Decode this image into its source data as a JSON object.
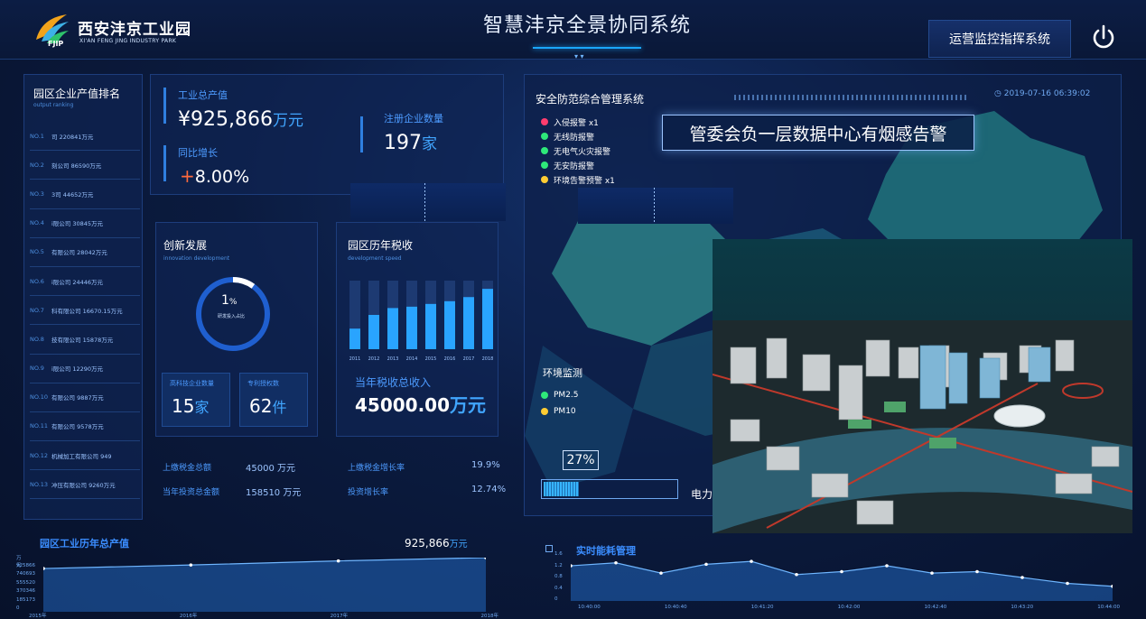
{
  "header": {
    "logo_cn": "西安沣京工业园",
    "logo_en": "XI'AN FENG JING INDUSTRY PARK",
    "logo_abbr": "FJIP",
    "title": "智慧沣京全景协同系统",
    "ops_button": "运营监控指挥系统",
    "power_icon": "power-icon"
  },
  "ranking": {
    "title": "园区企业产值排名",
    "subtitle": "output ranking",
    "items": [
      {
        "no": "NO.1",
        "text": "司 220841万元"
      },
      {
        "no": "NO.2",
        "text": "刻公司 86590万元"
      },
      {
        "no": "NO.3",
        "text": "3司 44652万元"
      },
      {
        "no": "NO.4",
        "text": "i限公司 30845万元"
      },
      {
        "no": "NO.5",
        "text": "有限公司 28042万元"
      },
      {
        "no": "NO.6",
        "text": "i限公司 24446万元"
      },
      {
        "no": "NO.7",
        "text": "科有限公司 16670.15万元"
      },
      {
        "no": "NO.8",
        "text": "技有限公司 15878万元"
      },
      {
        "no": "NO.9",
        "text": "i限公司 12290万元"
      },
      {
        "no": "NO.10",
        "text": "有限公司 9887万元"
      },
      {
        "no": "NO.11",
        "text": "有限公司 9578万元"
      },
      {
        "no": "NO.12",
        "text": "机械加工有限公司 949"
      },
      {
        "no": "NO.13",
        "text": "冲压有限公司 9260万元"
      }
    ]
  },
  "stats": {
    "output_label": "工业总产值",
    "output_value": "¥925,866",
    "output_unit": "万元",
    "growth_label": "同比增长",
    "growth_sign": "+",
    "growth_value": "8.00%",
    "enterprise_label": "注册企业数量",
    "enterprise_value": "197",
    "enterprise_unit": "家"
  },
  "innovation": {
    "title": "创新发展",
    "subtitle": "innovation development",
    "ring_percent": 1,
    "ring_value": "1",
    "ring_pct_sign": "%",
    "ring_label": "研发投入占比",
    "hightech_label": "高科技企业数量",
    "hightech_value": "15",
    "hightech_unit": "家",
    "patent_label": "专利授权数",
    "patent_value": "62",
    "patent_unit": "件"
  },
  "tax": {
    "title": "园区历年税收",
    "subtitle": "development speed",
    "years": [
      "2011",
      "2012",
      "2013",
      "2014",
      "2015",
      "2016",
      "2017",
      "2018"
    ],
    "fill_fraction": [
      0.3,
      0.5,
      0.6,
      0.62,
      0.66,
      0.7,
      0.76,
      0.88
    ],
    "total_label": "当年税收总收入",
    "total_value": "45000.00",
    "total_unit": "万元"
  },
  "bottom_stats": {
    "last_tax_label": "上缴税金总额",
    "last_tax_value": "45000 万元",
    "last_tax_growth_label": "上缴税金增长率",
    "last_tax_growth_value": "19.9%",
    "investment_label": "当年投资总金额",
    "investment_value": "158510 万元",
    "investment_growth_label": "投资增长率",
    "investment_growth_value": "12.74%"
  },
  "security": {
    "title": "安全防范综合管理系统",
    "timestamp": "2019-07-16 06:39:02",
    "alert": "管委会负一层数据中心有烟感告警",
    "legend": [
      {
        "label": "入侵报警 x1",
        "color": "#ff3d6e"
      },
      {
        "label": "无线防报警",
        "color": "#2ee87a"
      },
      {
        "label": "无电气火灾报警",
        "color": "#2ee87a"
      },
      {
        "label": "无安防报警",
        "color": "#2ee87a"
      },
      {
        "label": "环境告警预警 x1",
        "color": "#ffcc33"
      }
    ],
    "env_title": "环境监测",
    "env_items": [
      {
        "label": "PM2.5",
        "color": "#2ee87a"
      },
      {
        "label": "PM10",
        "color": "#ffcc33"
      }
    ],
    "progress_label": "27%",
    "progress": 0.27,
    "power_label": "电力"
  },
  "output_history": {
    "title": "园区工业历年总产值",
    "value": "925,866",
    "unit": "万元",
    "y_ticks": [
      "万元",
      "925866",
      "740693",
      "555520",
      "370346",
      "185173",
      "0"
    ],
    "x_ticks": [
      "2015年",
      "2016年",
      "2017年",
      "2018年"
    ]
  },
  "energy": {
    "title": "实时能耗管理",
    "y_ticks": [
      "1.6",
      "1.2",
      "0.8",
      "0.4",
      "0"
    ],
    "x_ticks": [
      "10:40:00",
      "10:40:40",
      "10:41:20",
      "10:42:00",
      "10:42:40",
      "10:43:20",
      "10:44:00"
    ]
  },
  "chart_data": [
    {
      "type": "area",
      "title": "园区工业历年总产值",
      "x": [
        "2015年",
        "2016年",
        "2017年",
        "2018年"
      ],
      "values": [
        740000,
        800000,
        870000,
        925866
      ],
      "ylim": [
        0,
        925866
      ]
    },
    {
      "type": "area",
      "title": "实时能耗管理",
      "x": [
        "10:40:00",
        "10:40:20",
        "10:40:40",
        "10:41:00",
        "10:41:20",
        "10:41:40",
        "10:42:00",
        "10:42:20",
        "10:42:40",
        "10:43:00",
        "10:43:20",
        "10:43:40",
        "10:44:00"
      ],
      "values": [
        1.2,
        1.3,
        0.95,
        1.25,
        1.35,
        0.9,
        1.0,
        1.2,
        0.95,
        1.0,
        0.8,
        0.6,
        0.5
      ],
      "ylim": [
        0,
        1.6
      ]
    },
    {
      "type": "bar",
      "title": "园区历年税收",
      "categories": [
        "2011",
        "2012",
        "2013",
        "2014",
        "2015",
        "2016",
        "2017",
        "2018"
      ],
      "values": [
        0.3,
        0.5,
        0.6,
        0.62,
        0.66,
        0.7,
        0.76,
        0.88
      ]
    }
  ]
}
